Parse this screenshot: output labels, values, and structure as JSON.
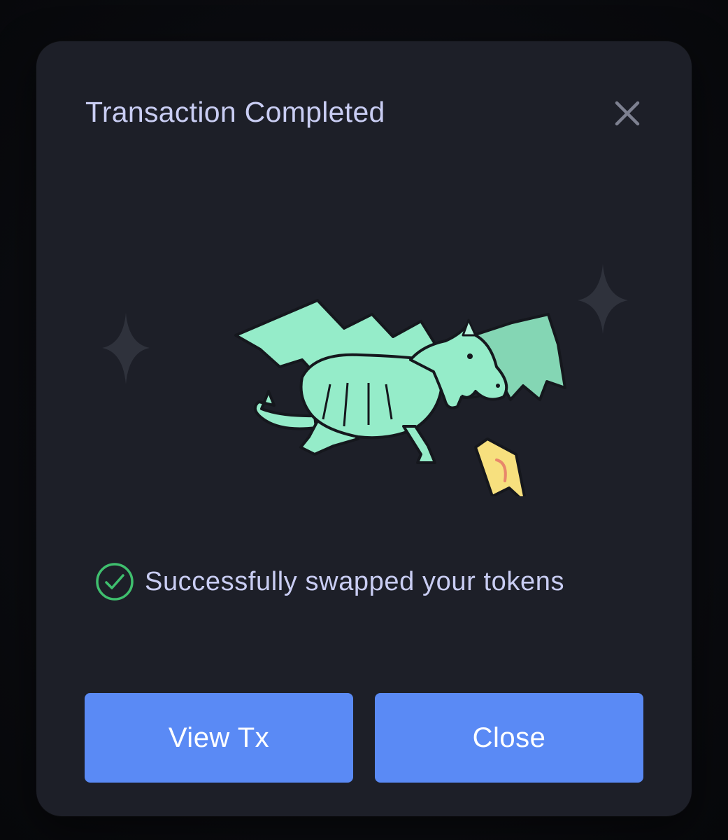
{
  "modal": {
    "title": "Transaction Completed",
    "close_icon": "close-icon",
    "illustration": "dragon-with-token-illustration",
    "status": {
      "icon": "check-circle-icon",
      "text": "Successfully swapped your tokens"
    },
    "buttons": {
      "view_tx_label": "View Tx",
      "close_label": "Close"
    }
  },
  "colors": {
    "background": "#0b0c10",
    "modal": "#1d1f28",
    "title_text": "#c9cdf3",
    "accent_button": "#5a8af5",
    "success": "#3fbf6e",
    "dragon": "#95ecc9",
    "token": "#f7e07e"
  }
}
